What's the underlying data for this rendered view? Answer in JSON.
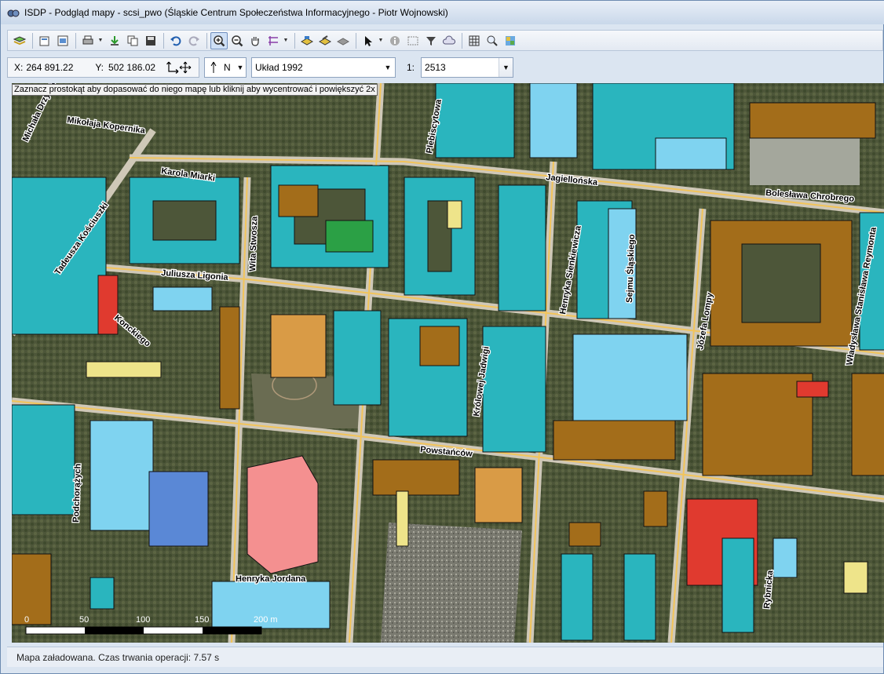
{
  "window": {
    "title": "ISDP - Podgląd mapy - scsi_pwo (Śląskie Centrum Społeczeństwa Informacyjnego - Piotr Wojnowski)"
  },
  "toolbar": {
    "buttons": [
      "layers-icon",
      "properties-icon",
      "print-preview-icon",
      "print-icon",
      "export-icon",
      "copy-icon",
      "save-icon",
      "undo-icon",
      "redo-icon",
      "zoom-in-icon",
      "zoom-out-icon",
      "pan-icon",
      "measure-icon",
      "layer-add-icon",
      "layer-edit-icon",
      "layer-remove-icon",
      "select-icon",
      "info-icon",
      "select-area-icon",
      "filter-icon",
      "cloud-icon",
      "grid-icon",
      "find-icon",
      "map-icon"
    ]
  },
  "coords": {
    "x_label": "X:",
    "x_value": "264 891.22",
    "y_label": "Y:",
    "y_value": "502 186.02",
    "north_value": "N",
    "crs_value": "Układ 1992",
    "scale_prefix": "1:",
    "scale_value": "2513"
  },
  "hint": "Zaznacz prostokąt aby dopasować do niego mapę lub kliknij aby wycentrować i powiększyć 2x",
  "map": {
    "street_labels": [
      "Mikołaja Kopernika",
      "Michała Drzymały",
      "Tadeusza Kościuszki",
      "Karola Miarki",
      "Juliusza Ligonia",
      "Wita Stwosza",
      "Plebiscytowa",
      "Jagiellońska",
      "Henryka Sienkiewicza",
      "Józefa Lompy",
      "Bolesława Chrobrego",
      "Sejmu Śląskiego",
      "Królowej Jadwigi",
      "Konckiego",
      "Powstańców",
      "Podchorążych",
      "Henryka Jordana",
      "Rybnicka",
      "Władysława Stanisława Reymonta"
    ],
    "scale_labels": [
      "0",
      "50",
      "100",
      "150",
      "200 m"
    ]
  },
  "status": {
    "text": "Mapa załadowana. Czas trwania operacji: 7.57 s"
  },
  "colors": {
    "residential": "#2ab5be",
    "service": "#a36d1a",
    "garage": "#2ba045",
    "commercial": "#7fd3f0",
    "public": "#f08080",
    "transport": "#eee48a",
    "industrial": "#e03a2f"
  }
}
